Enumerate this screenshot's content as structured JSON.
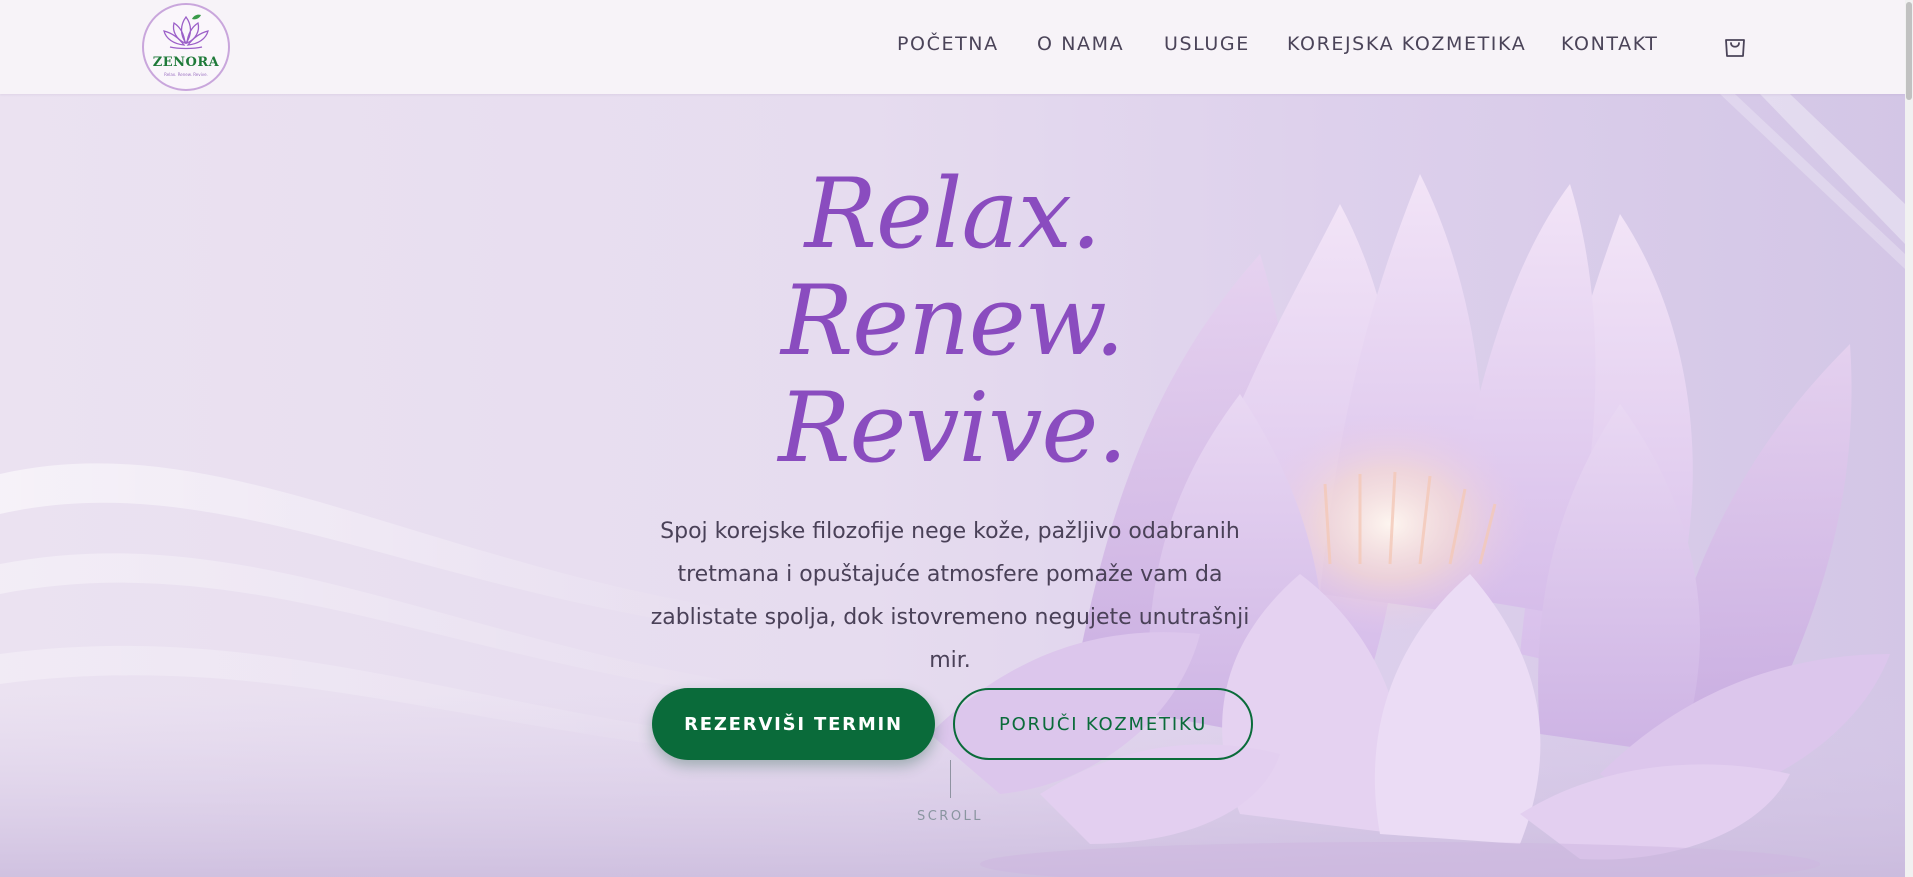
{
  "brand": {
    "name": "ZENORA",
    "tagline": "Relax. Renew. Revive."
  },
  "nav": {
    "items": [
      {
        "label": "POČETNA"
      },
      {
        "label": "O NAMA"
      },
      {
        "label": "USLUGE"
      },
      {
        "label": "KOREJSKA KOZMETIKA"
      },
      {
        "label": "KONTAKT"
      }
    ],
    "cart_icon": "shopping-bag-icon"
  },
  "hero": {
    "headline": [
      "Relax.",
      "Renew.",
      "Revive."
    ],
    "subtitle": "Spoj korejske filozofije nege kože, pažljivo odabranih tretmana i opuštajuće atmosfere pomaže vam da zablistate spolja, dok istovremeno negujete unutrašnji mir.",
    "primary_cta": "REZERVIŠI TERMIN",
    "secondary_cta": "PORUČI KOZMETIKU",
    "scroll_label": "SCROLL",
    "background_image": "lotus-flower"
  },
  "colors": {
    "accent_purple": "#8a4cbf",
    "brand_green": "#0a6b3a",
    "header_bg": "#f7f3f8",
    "text_dark": "#4a4158"
  }
}
